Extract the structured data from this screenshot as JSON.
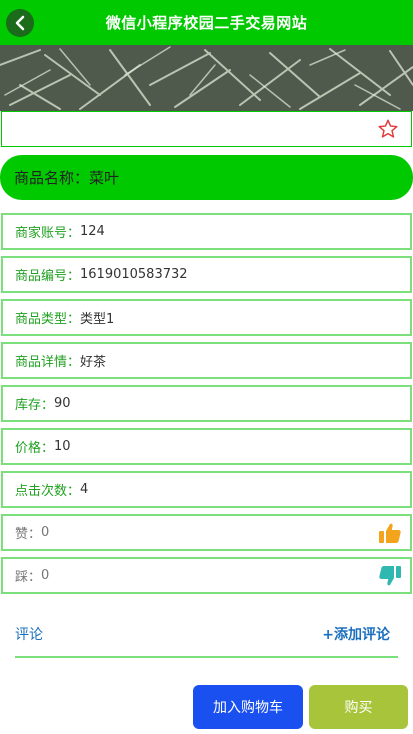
{
  "header": {
    "title": "微信小程序校园二手交易网站",
    "back_icon": "chevron-left-icon"
  },
  "banner": {
    "image": "tea-leaves-photo"
  },
  "favorite": {
    "icon": "star-outline-icon"
  },
  "product": {
    "name_label": "商品名称：",
    "name_value": "菜叶"
  },
  "details": [
    {
      "label": "商家账号：",
      "value": "124"
    },
    {
      "label": "商品编号：",
      "value": "1619010583732"
    },
    {
      "label": "商品类型：",
      "value": "类型1"
    },
    {
      "label": "商品详情：",
      "value": "好茶"
    },
    {
      "label": "库存：",
      "value": "90"
    },
    {
      "label": "价格：",
      "value": "10"
    },
    {
      "label": "点击次数：",
      "value": "4"
    }
  ],
  "votes": {
    "like_label": "赞：",
    "like_value": "0",
    "like_icon": "thumbs-up-icon",
    "dislike_label": "踩：",
    "dislike_value": "0",
    "dislike_icon": "thumbs-down-icon"
  },
  "comments": {
    "label": "评论",
    "add_label": "+添加评论"
  },
  "actions": {
    "cart_label": "加入购物车",
    "buy_label": "购买"
  },
  "colors": {
    "accent": "#00c900",
    "border": "#7be07b",
    "cart": "#1a4ff0",
    "buy": "#a8c43a",
    "link": "#1a6fbe"
  }
}
